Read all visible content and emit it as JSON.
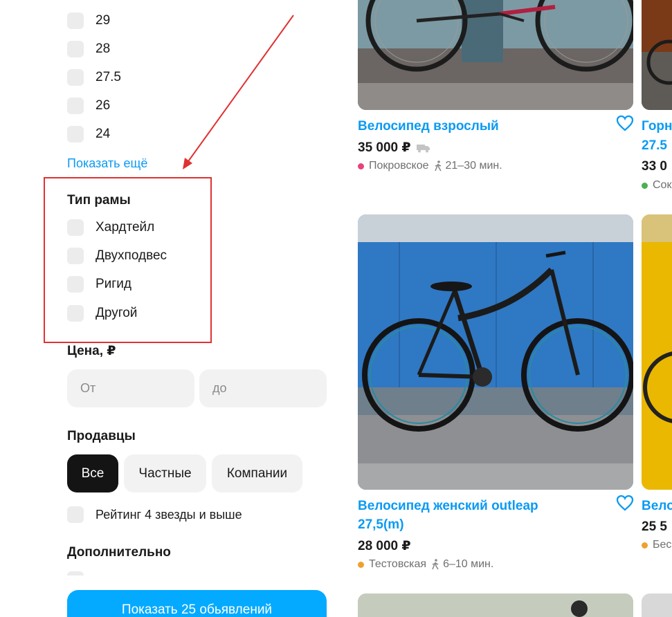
{
  "filters": {
    "wheel_size_options": [
      "29",
      "28",
      "27.5",
      "26",
      "24"
    ],
    "show_more": "Показать ещё",
    "frame_type": {
      "title": "Тип рамы",
      "options": [
        "Хардтейл",
        "Двухподвес",
        "Ригид",
        "Другой"
      ]
    },
    "price": {
      "title": "Цена, ₽",
      "from_placeholder": "От",
      "to_placeholder": "до"
    },
    "sellers": {
      "title": "Продавцы",
      "options": [
        "Все",
        "Частные",
        "Компании"
      ],
      "selected": "Все"
    },
    "rating_label": "Рейтинг 4 звезды и выше",
    "extra_title": "Дополнительно",
    "show_results_button": "Показать 25 обьявлений"
  },
  "listings": [
    {
      "title": "Велосипед взрослый",
      "price": "35 000 ₽",
      "delivery": true,
      "station": "Покровское",
      "station_color": "#e8427c",
      "walk_time": "21–30 мин."
    },
    {
      "title_line1": "Велосипед женский outleap",
      "title_line2": "27,5(m)",
      "price": "28 000 ₽",
      "station": "Тестовская",
      "station_color": "#f0a030",
      "walk_time": "6–10 мин."
    }
  ],
  "right_column_partial": {
    "item1_title": "Горн",
    "item1_subtitle": "27.5",
    "item1_price": "33 0",
    "item1_station": "Сок",
    "item1_station_color": "#4caf50",
    "item2_title": "Вело",
    "item2_price": "25 5",
    "item2_station": "Бес",
    "item2_station_color": "#f0a030"
  },
  "colors": {
    "accent_link": "#0a9af3",
    "cta": "#04aaff",
    "annotation": "#e03131"
  }
}
